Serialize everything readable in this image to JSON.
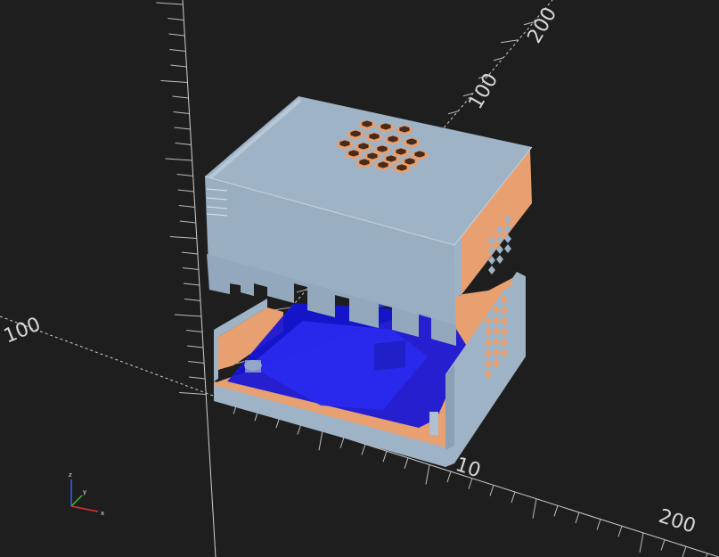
{
  "app": {
    "view": "3d-preview"
  },
  "axes": {
    "tick_labels": [
      {
        "id": "y100",
        "text": "100"
      },
      {
        "id": "y200",
        "text": "200"
      },
      {
        "id": "x10",
        "text": "10"
      },
      {
        "id": "x200",
        "text": "200"
      },
      {
        "id": "xneg100",
        "text": "100"
      }
    ]
  },
  "gizmo": {
    "x": "x",
    "y": "y",
    "z": "z"
  },
  "model": {
    "lid_color": "#9fb3c6",
    "base_color": "#9fb3c6",
    "inner_color": "#e8a070",
    "board_color": "#1a1ae0"
  }
}
